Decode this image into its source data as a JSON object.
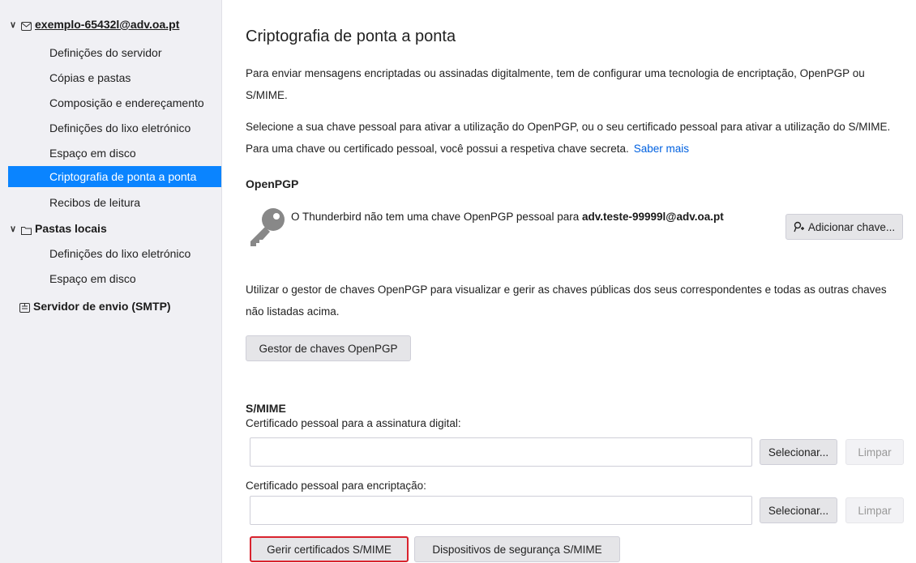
{
  "sidebar": {
    "account": {
      "label": "exemplo-65432l@adv.oa.pt"
    },
    "account_items": [
      {
        "label": "Definições do servidor"
      },
      {
        "label": "Cópias e pastas"
      },
      {
        "label": "Composição e endereçamento"
      },
      {
        "label": "Definições do lixo eletrónico"
      },
      {
        "label": "Espaço em disco"
      },
      {
        "label": "Criptografia de ponta a ponta",
        "selected": true
      },
      {
        "label": "Recibos de leitura"
      }
    ],
    "local_folders": {
      "label": "Pastas locais"
    },
    "local_items": [
      {
        "label": "Definições do lixo eletrónico"
      },
      {
        "label": "Espaço em disco"
      }
    ],
    "smtp": {
      "label": "Servidor de envio (SMTP)"
    }
  },
  "main": {
    "title": "Criptografia de ponta a ponta",
    "intro": "Para enviar mensagens encriptadas ou assinadas digitalmente, tem de configurar uma tecnologia de encriptação, OpenPGP ou S/MIME.",
    "select_text": "Selecione a sua chave pessoal para ativar a utilização do OpenPGP, ou o seu certificado pessoal para ativar a utilização do S/MIME. Para uma chave ou certificado pessoal, você possui a respetiva chave secreta.",
    "learn_more": "Saber mais",
    "openpgp": {
      "heading": "OpenPGP",
      "no_key_text": "O Thunderbird não tem uma chave OpenPGP pessoal para",
      "no_key_email": "adv.teste-99999l@adv.oa.pt",
      "add_key_button": "Adicionar chave...",
      "manager_text": "Utilizar o gestor de chaves OpenPGP para visualizar e gerir as chaves públicas dos seus correspondentes e todas as outras chaves não listadas acima.",
      "manager_button": "Gestor de chaves OpenPGP"
    },
    "smime": {
      "heading": "S/MIME",
      "sign_label": "Certificado pessoal para a assinatura digital:",
      "sign_value": "",
      "enc_label": "Certificado pessoal para encriptação:",
      "enc_value": "",
      "select_button": "Selecionar...",
      "clear_button": "Limpar",
      "manage_certs_button": "Gerir certificados S/MIME",
      "devices_button": "Dispositivos de segurança S/MIME"
    }
  },
  "colors": {
    "accent": "#0a84ff",
    "link": "#0061e0",
    "highlight": "#d9232e"
  },
  "icons": [
    "chevron-down-icon",
    "envelope-icon",
    "folder-icon",
    "server-icon",
    "key-icon",
    "add-key-icon"
  ]
}
